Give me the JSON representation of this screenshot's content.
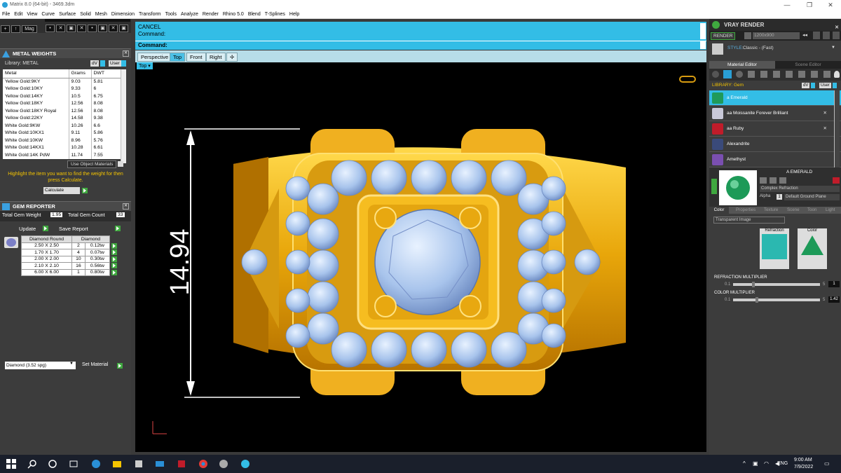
{
  "titlebar": {
    "title": "Matrix 8.0 (64-bit) - 3469.3dm"
  },
  "menu": [
    "File",
    "Edit",
    "View",
    "Curve",
    "Surface",
    "Solid",
    "Mesh",
    "Dimension",
    "Transform",
    "Tools",
    "Analyze",
    "Render",
    "Rhino 5.0",
    "Blend",
    "T-Splines",
    "Help"
  ],
  "metal_weights": {
    "title": "METAL WEIGHTS",
    "library_label": "Library: METAL",
    "dv_label": "dV",
    "user_label": "User",
    "columns": [
      "Metal",
      "Grams",
      "DWT"
    ],
    "rows": [
      [
        "Yellow Gold:9KY",
        "9.03",
        "5.81"
      ],
      [
        "Yellow Gold:10KY",
        "9.33",
        "6"
      ],
      [
        "Yellow Gold:14KY",
        "10.5",
        "6.75"
      ],
      [
        "Yellow Gold:18KY",
        "12.56",
        "8.08"
      ],
      [
        "Yellow Gold:18KY Royal",
        "12.56",
        "8.08"
      ],
      [
        "Yellow Gold:22KY",
        "14.58",
        "9.38"
      ],
      [
        "White Gold:9KW",
        "10.26",
        "6.6"
      ],
      [
        "White Gold:10KX1",
        "9.11",
        "5.86"
      ],
      [
        "White Gold:10KW",
        "8.96",
        "5.76"
      ],
      [
        "White Gold:14KX1",
        "10.28",
        "6.61"
      ],
      [
        "White Gold:14K PdW",
        "11.74",
        "7.55"
      ]
    ],
    "use_object_materials": "Use Object Materials",
    "hint": "Highlight the item you want to find the weight for then press Calculate.",
    "calculate_label": "Calculate"
  },
  "gem_reporter": {
    "title": "GEM REPORTER",
    "total_weight_label": "Total Gem Weight",
    "total_weight_value": "1.95",
    "total_count_label": "Total Gem Count",
    "total_count_value": "33",
    "update_label": "Update",
    "save_report_label": "Save Report",
    "columns": [
      "Diamond Round",
      "Diamond"
    ],
    "rows": [
      [
        "2.50 X 2.50",
        "2",
        "0.12tw"
      ],
      [
        "1.70 X 1.70",
        "4",
        "0.07tw"
      ],
      [
        "2.00 X 2.00",
        "10",
        "0.30tw"
      ],
      [
        "2.10 X 2.10",
        "16",
        "0.56tw"
      ],
      [
        "6.00 X 6.00",
        "1",
        "0.80tw"
      ]
    ],
    "material_select": "Diamond    (3.52 spg)",
    "set_material_label": "Set Material"
  },
  "command": {
    "cancel": "CANCEL",
    "line1": "Command:",
    "prompt": "Command:"
  },
  "viewport_tabs": [
    "Perspective",
    "Top",
    "Front",
    "Right"
  ],
  "active_view": "Top",
  "view_label": "Top",
  "dimension_text": "14.94",
  "vray": {
    "title": "VRAY RENDER",
    "render_label": "RENDER",
    "resolution": "1200x900",
    "style_label": "STYLE:",
    "style_value": "Classic - (Fast)",
    "tabs": [
      "Material Editor",
      "Scene Editor"
    ],
    "library_label": "LIBRARY: Gem",
    "dv_label": "dV",
    "user_label": "User",
    "materials": [
      {
        "name": "a Emerald",
        "color": "#1f9a5a"
      },
      {
        "name": "aa Moissanite Forever Brilliant",
        "color": "#c8c8d8"
      },
      {
        "name": "aa Ruby",
        "color": "#c01c2a"
      },
      {
        "name": "Alexandrite",
        "color": "#3a4a7a"
      },
      {
        "name": "Amethyst",
        "color": "#7a4fb0"
      }
    ],
    "selected_material": "A EMERALD",
    "option1": "Complex Refraction",
    "alpha_label": "Alpha",
    "alpha_value": "1",
    "ground_plane": "Default Ground Plane",
    "subtabs": [
      "Color",
      "Properties",
      "Texture",
      "Scene",
      "Toon",
      "Light"
    ],
    "transparent_image": "Transparent Image",
    "refraction_label": "Refraction",
    "color_label": "Color",
    "refraction_multiplier_label": "REFRACTION MULTIPLIER",
    "refraction_multiplier_min": "0.1",
    "refraction_multiplier_max": "5",
    "refraction_multiplier_value": "1",
    "color_multiplier_label": "COLOR MULTIPLIER",
    "color_multiplier_min": "0.1",
    "color_multiplier_max": "5",
    "color_multiplier_value": "1.42"
  },
  "taskbar": {
    "language": "ENG",
    "time": "9:00 AM",
    "date": "7/9/2022"
  }
}
